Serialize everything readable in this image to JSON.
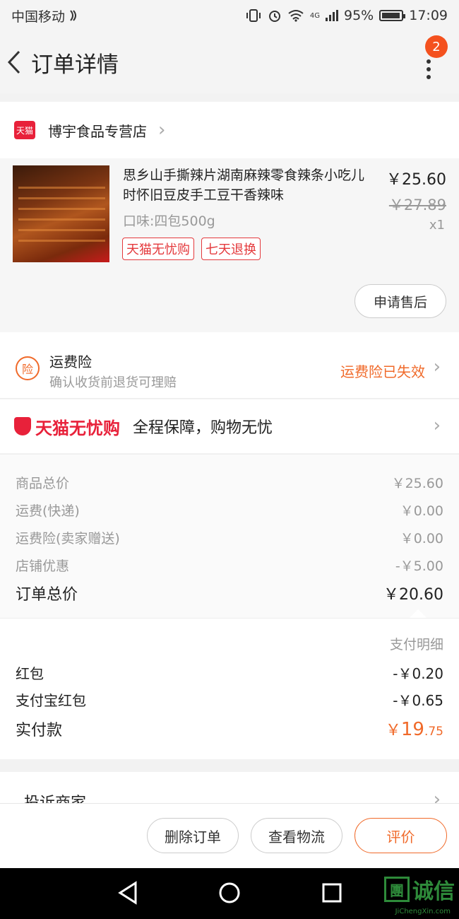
{
  "status_bar": {
    "carrier": "中国移动",
    "network": "4G",
    "battery": "95%",
    "battery_level": 0.95,
    "time": "17:09"
  },
  "nav": {
    "title": "订单详情",
    "badge": "2"
  },
  "shop": {
    "badge_text": "天猫",
    "name": "博宇食品专营店"
  },
  "product": {
    "title": "思乡山手撕辣片湖南麻辣零食辣条小吃儿时怀旧豆皮手工豆干香辣味",
    "spec": "口味:四包500g",
    "tags": [
      "天猫无忧购",
      "七天退换"
    ],
    "price": "￥25.60",
    "original_price": "￥27.89",
    "quantity": "x1",
    "after_sale_label": "申请售后"
  },
  "insurance": {
    "icon_text": "险",
    "title": "运费险",
    "subtitle": "确认收货前退货可理赔",
    "status": "运费险已失效"
  },
  "guarantee": {
    "logo_text": "天猫无忧购",
    "text": "全程保障，购物无忧"
  },
  "summary": {
    "rows": [
      {
        "label": "商品总价",
        "value": "￥25.60"
      },
      {
        "label": "运费(快递)",
        "value": "￥0.00"
      },
      {
        "label": "运费险(卖家赠送)",
        "value": "￥0.00"
      },
      {
        "label": "店铺优惠",
        "value": "-￥5.00"
      }
    ],
    "total_label": "订单总价",
    "total_value": "￥20.60"
  },
  "payment": {
    "detail_link": "支付明细",
    "rows": [
      {
        "label": "红包",
        "value": "-￥0.20"
      },
      {
        "label": "支付宝红包",
        "value": "-￥0.65"
      }
    ],
    "paid_label": "实付款",
    "paid_currency": "￥",
    "paid_int": "19",
    "paid_dec": ".75"
  },
  "complain": {
    "label": "投诉商家"
  },
  "actions": {
    "delete": "删除订单",
    "logistics": "查看物流",
    "review": "评价"
  },
  "watermark": {
    "brand": "诚信",
    "box_char": "團",
    "domain": "JiChengXin.com"
  },
  "colors": {
    "accent": "#f06a2a",
    "tmall_red": "#e8213a"
  }
}
